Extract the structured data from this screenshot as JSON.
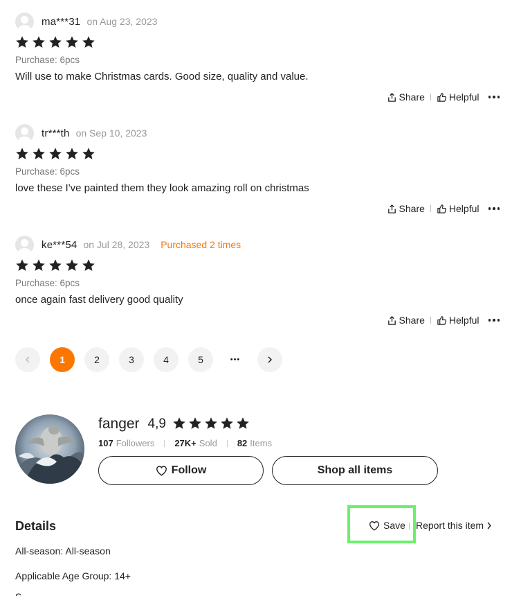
{
  "reviews": [
    {
      "user": "ma***31",
      "date": "on Aug 23, 2023",
      "purchased_times": "",
      "rating": 5,
      "purchase": "Purchase: 6pcs",
      "comment": "Will use to make Christmas cards. Good size, quality and value."
    },
    {
      "user": "tr***th",
      "date": "on Sep 10, 2023",
      "purchased_times": "",
      "rating": 5,
      "purchase": "Purchase: 6pcs",
      "comment": "love these I've painted them they look amazing roll on christmas"
    },
    {
      "user": "ke***54",
      "date": "on Jul 28, 2023",
      "purchased_times": "Purchased 2 times",
      "rating": 5,
      "purchase": "Purchase: 6pcs",
      "comment": "once again fast delivery good quality"
    }
  ],
  "actions": {
    "share": "Share",
    "helpful": "Helpful"
  },
  "pagination": {
    "pages": [
      "1",
      "2",
      "3",
      "4",
      "5"
    ],
    "current": "1",
    "ellipsis": "•••"
  },
  "store": {
    "name": "fanger",
    "rating": "4,9",
    "followers_count": "107",
    "followers_label": "Followers",
    "sold_count": "27K+",
    "sold_label": "Sold",
    "items_count": "82",
    "items_label": "Items",
    "follow_label": "Follow",
    "shop_all_label": "Shop all items"
  },
  "details": {
    "title": "Details",
    "save_label": "Save",
    "report_label": "Report this item",
    "rows": [
      "All-season: All-season",
      "Applicable Age Group: 14+",
      "S"
    ]
  },
  "colors": {
    "accent": "#fb7701",
    "highlight": "#6bf06b"
  }
}
